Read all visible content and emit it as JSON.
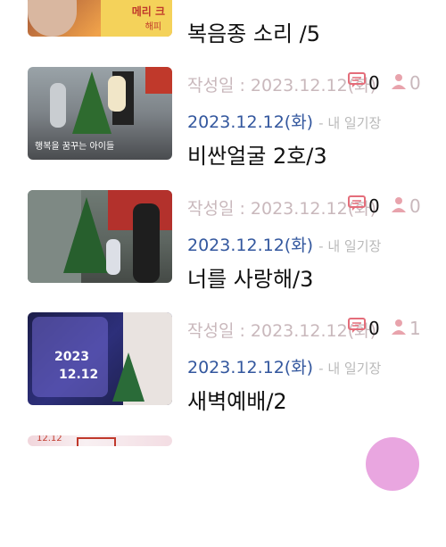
{
  "colors": {
    "date": "#33579e",
    "meta": "#c9b8bc",
    "accent": "#e46d7a",
    "title": "#111111"
  },
  "posts": [
    {
      "title": "복음종 소리 /5",
      "thumb_caption": "메리 크",
      "thumb_caption2": "해피"
    },
    {
      "written_label": "작성일 : 2023.12.12(화)",
      "comments": "0",
      "views": "0",
      "date": "2023.12.12(화)",
      "source": "- 내 일기장",
      "title": "비싼얼굴 2호/3",
      "thumb_caption": "행복을 꿈꾸는 아이들"
    },
    {
      "written_label": "작성일 : 2023.12.12(화)",
      "comments": "0",
      "views": "0",
      "date": "2023.12.12(화)",
      "source": "- 내 일기장",
      "title": "너를 사랑해/3"
    },
    {
      "written_label": "작성일 : 2023.12.12(화)",
      "comments": "0",
      "views": "1",
      "date": "2023.12.12(화)",
      "source": "- 내 일기장",
      "title": "새벽예배/2",
      "thumb_caption": "2023",
      "thumb_caption2": "12.12"
    },
    {
      "thumb_caption": "12.12"
    }
  ]
}
